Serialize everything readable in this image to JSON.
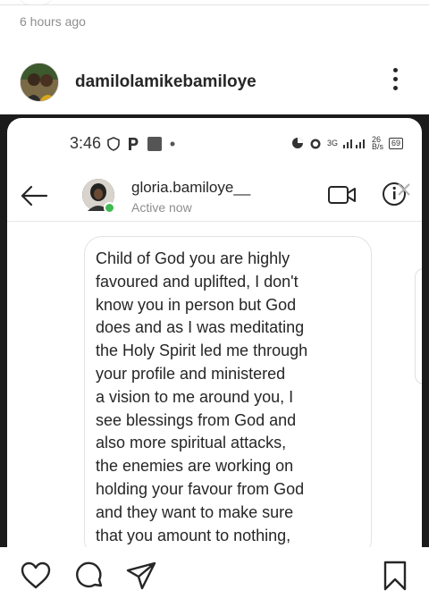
{
  "post": {
    "timestamp": "6 hours ago",
    "username": "damilolamikebamiloye"
  },
  "screenshot": {
    "status_bar": {
      "time": "3:46",
      "network": "3G",
      "speed_value": "26",
      "speed_unit": "B/s",
      "battery": "69"
    },
    "dm": {
      "name": "gloria.bamiloye__",
      "status": "Active now"
    },
    "message_lines": [
      "Child of God you are highly",
      "favoured and uplifted, I don't",
      "know you in person but God",
      "does and as I was meditating",
      "the Holy Spirit led me through",
      "your profile and ministered",
      "a vision to me around you, I",
      "see blessings from God and",
      "also more spiritual attacks,",
      "the enemies are working on",
      "holding your favour from God",
      "and they want to make sure",
      "that you amount to nothing,"
    ]
  },
  "icons": {
    "more": "more-vertical-icon",
    "like": "heart-icon",
    "comment": "comment-icon",
    "share": "send-icon",
    "save": "bookmark-icon"
  },
  "colors": {
    "online": "#3fb950",
    "muted_text": "#8e8e8e"
  }
}
